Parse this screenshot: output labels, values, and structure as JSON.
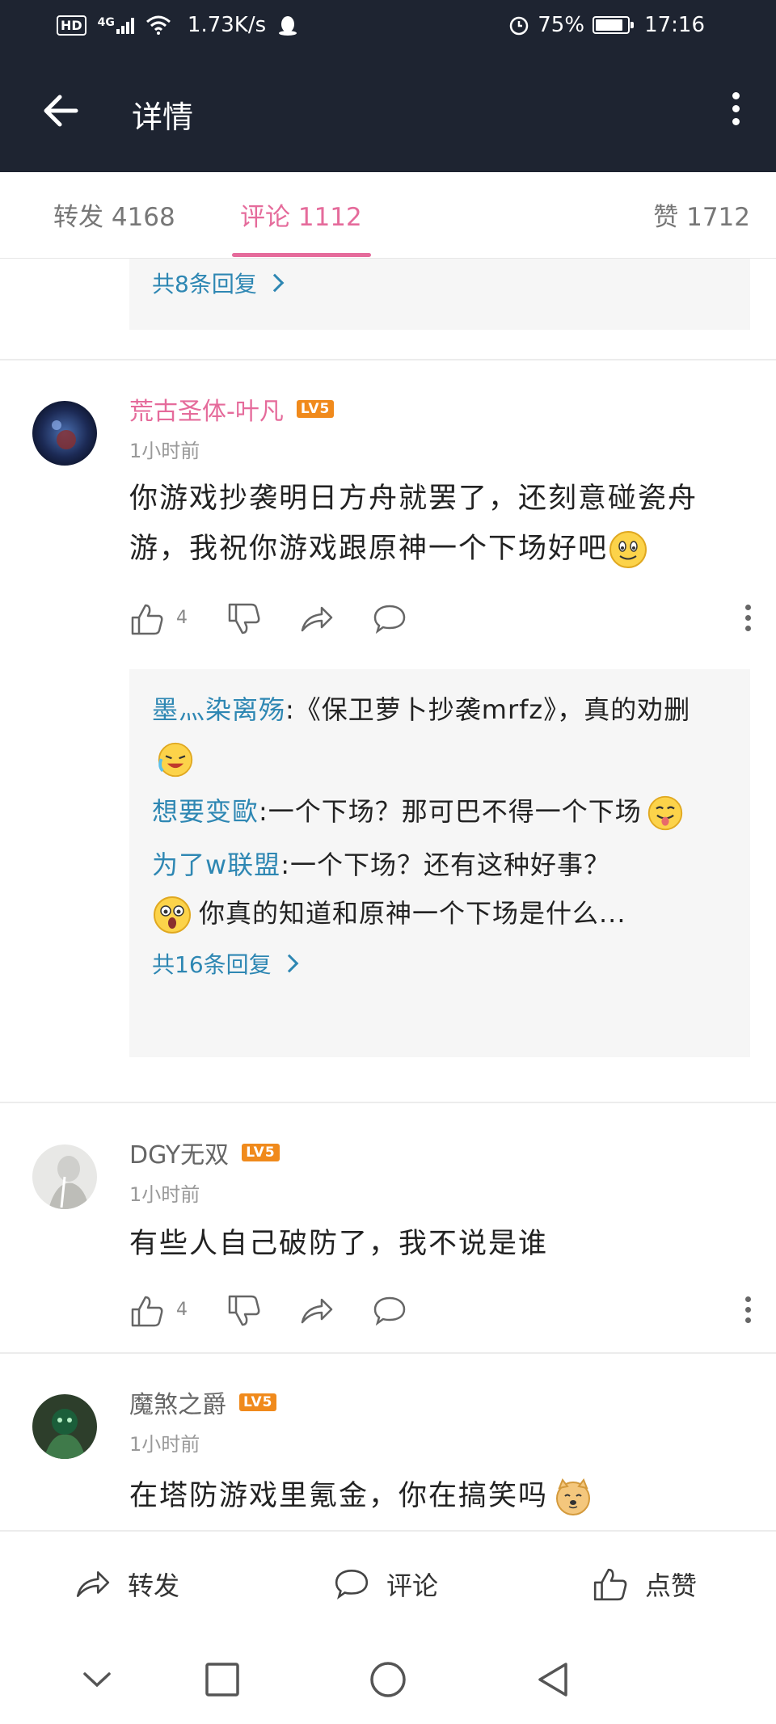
{
  "status_bar": {
    "hd": "HD",
    "network": "4G",
    "speed": "1.73K/s",
    "battery": "75%",
    "time": "17:16"
  },
  "header": {
    "title": "详情"
  },
  "tabs": {
    "repost": "转发 4168",
    "comments": "评论 1112",
    "likes": "赞 1712"
  },
  "top_replies": {
    "more": "共8条回复"
  },
  "comments": [
    {
      "user": "荒古圣体-叶凡",
      "level": "LV5",
      "time": "1小时前",
      "text": "你游戏抄袭明日方舟就罢了，还刻意碰瓷舟游，我祝你游戏跟原神一个下场好吧",
      "likes": "4",
      "replies": [
        {
          "user": "墨灬染离殇",
          "sep": ":",
          "text": "《保卫萝卜抄袭mrfz》，真的劝删"
        },
        {
          "user": "想要变歐",
          "sep": ":",
          "text": "一个下场？那可巴不得一个下场"
        },
        {
          "user": "为了w联盟",
          "sep": ":",
          "text": "一个下场？还有这种好事？"
        },
        {
          "text": "你真的知道和原神一个下场是什么..."
        }
      ],
      "more_replies": "共16条回复"
    },
    {
      "user": "DGY无双",
      "level": "LV5",
      "time": "1小时前",
      "text": "有些人自己破防了，我不说是谁",
      "likes": "4"
    },
    {
      "user": "魔煞之爵",
      "level": "LV5",
      "time": "1小时前",
      "text": "在塔防游戏里氪金，你在搞笑吗"
    }
  ],
  "bottom_bar": {
    "repost": "转发",
    "comment": "评论",
    "like": "点赞"
  },
  "colors": {
    "header_bg": "#1e2431",
    "accent_pink": "#e56b9b",
    "link_blue": "#2e87b3",
    "level_badge": "#f08a1c"
  }
}
